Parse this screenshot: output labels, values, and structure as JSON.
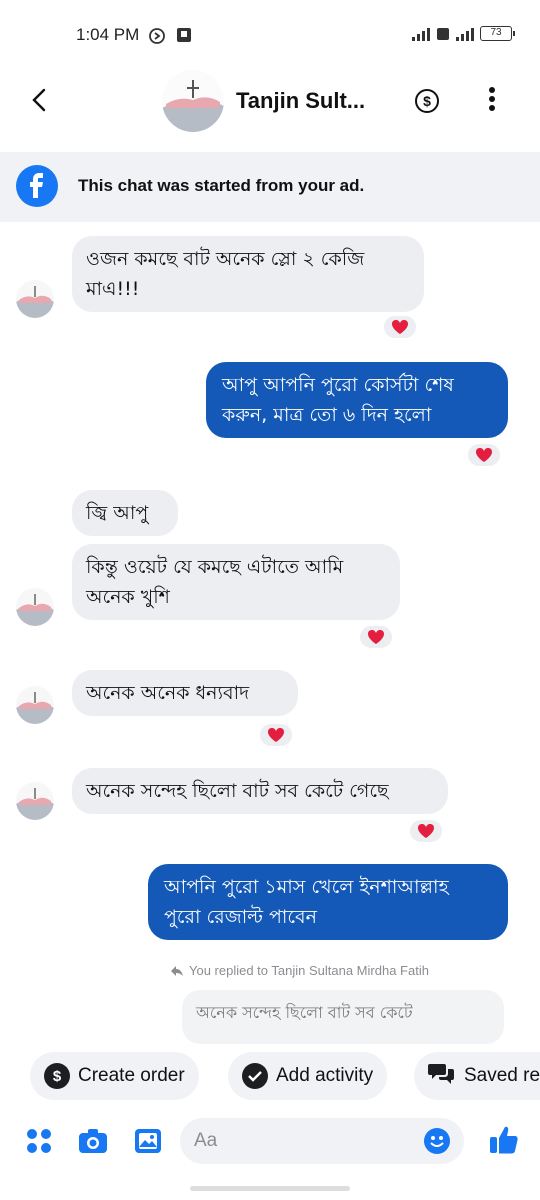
{
  "status_bar": {
    "time": "1:04 PM",
    "battery": "73"
  },
  "header": {
    "contact_name": "Tanjin Sult..."
  },
  "ad_banner": {
    "text": "This chat was started from your ad."
  },
  "messages": [
    {
      "direction": "incoming",
      "text_line1": "ওজন কমছে বাট অনেক স্লো ২ কেজি",
      "text_line2": "মাএ!!!",
      "reaction": "heart"
    },
    {
      "direction": "outgoing",
      "text_line1": "আপু আপনি পুরো কোর্সটা শেষ",
      "text_line2": "করুন, মাত্র তো ৬ দিন হলো",
      "reaction": "heart"
    },
    {
      "direction": "incoming",
      "text_line1": "জ্বি আপু"
    },
    {
      "direction": "incoming",
      "text_line1": "কিন্তু ওয়েট যে কমছে এটাতে আমি",
      "text_line2": "অনেক খুশি",
      "reaction": "heart"
    },
    {
      "direction": "incoming",
      "text_line1": "অনেক অনেক ধন্যবাদ",
      "reaction": "heart"
    },
    {
      "direction": "incoming",
      "text_line1": "অনেক সন্দেহ ছিলো বাট সব কেটে গেছে",
      "reaction": "heart"
    },
    {
      "direction": "outgoing",
      "text_line1": "আপনি পুরো ১মাস খেলে ইনশাআল্লাহ",
      "text_line2": "পুরো রেজাল্ট পাবেন"
    }
  ],
  "reply_context": {
    "label": "You replied to Tanjin Sultana Mirdha Fatih",
    "quoted_text": "অনেক সন্দেহ ছিলো বাট সব কেটে"
  },
  "quick_actions": [
    {
      "label": "Create order",
      "icon": "dollar-icon"
    },
    {
      "label": "Add activity",
      "icon": "check-circle-icon"
    },
    {
      "label": "Saved re",
      "icon": "chat-bubbles-icon"
    }
  ],
  "composer": {
    "placeholder": "Aa"
  },
  "colors": {
    "accent": "#1877f2",
    "outgoing_bubble": "#1459b7",
    "incoming_bubble": "#eceef2",
    "reaction_heart": "#e41e3f"
  }
}
